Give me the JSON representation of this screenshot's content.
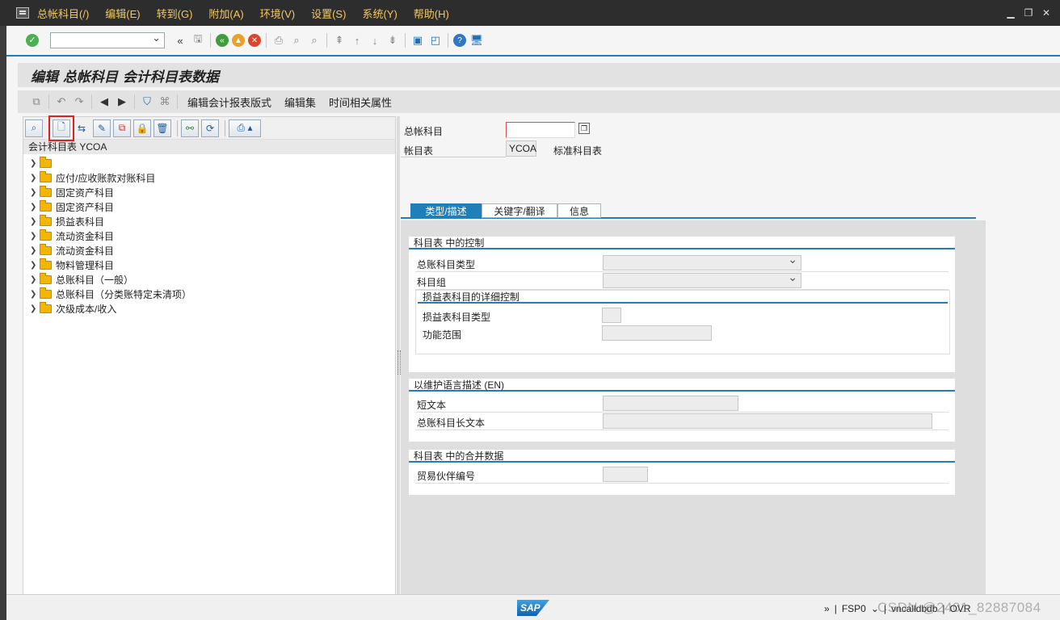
{
  "menu": {
    "items": [
      "总帐科目(/)",
      "编辑(E)",
      "转到(G)",
      "附加(A)",
      "环境(V)",
      "设置(S)",
      "系统(Y)",
      "帮助(H)"
    ]
  },
  "system_toolbar": {
    "back_symbol": "«",
    "command_field_value": ""
  },
  "page_title": "编辑 总帐科目 会计科目表数据",
  "app_toolbar": {
    "buttons": [
      "编辑会计报表版式",
      "编辑集",
      "时间相关属性"
    ]
  },
  "tree": {
    "header": "会计科目表 YCOA",
    "nodes": [
      "",
      "应付/应收账款对账科目",
      "固定资产科目",
      "固定资产科目",
      "损益表科目",
      "流动资金科目",
      "流动资金科目",
      "物料管理科目",
      "总账科目（一般）",
      "总账科目（分类账特定未清项）",
      "次级成本/收入"
    ]
  },
  "header_fields": {
    "gl_account_label": "总帐科目",
    "gl_account_value": "",
    "coa_label": "帐目表",
    "coa_value": "YCOA",
    "coa_desc": "标准科目表"
  },
  "tabs": [
    "类型/描述",
    "关键字/翻译",
    "信息"
  ],
  "groups": {
    "control": {
      "title": "科目表     中的控制",
      "gl_type_label": "总账科目类型",
      "account_group_label": "科目组",
      "pl_detail_title": "损益表科目的详细控制",
      "pl_type_label": "损益表科目类型",
      "func_area_label": "功能范围"
    },
    "description": {
      "title": "以维护语言描述 (EN)",
      "short_text_label": "短文本",
      "long_text_label": "总账科目长文本"
    },
    "consolidation": {
      "title": "科目表     中的合并数据",
      "trading_partner_label": "贸易伙伴编号"
    }
  },
  "status_bar": {
    "arrows": "»",
    "system": "FSP0",
    "user": "vncalldbdb",
    "mode": "OVR",
    "watermark": "CSDN @2401_82887084"
  }
}
